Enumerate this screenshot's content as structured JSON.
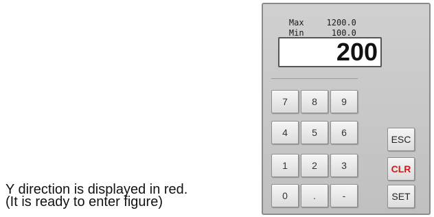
{
  "caption": {
    "line1": "Y direction is displayed in red.",
    "line2": "(It is ready to enter figure)"
  },
  "keypad": {
    "max_label": "Max",
    "max_value": "1200.0",
    "min_label": "Min",
    "min_value": "100.0",
    "display_value": "200",
    "keys": {
      "k7": "7",
      "k8": "8",
      "k9": "9",
      "k4": "4",
      "k5": "5",
      "k6": "6",
      "k1": "1",
      "k2": "2",
      "k3": "3",
      "k0": "0",
      "dot": ".",
      "minus": "-",
      "esc": "ESC",
      "clr": "CLR",
      "set": "SET"
    },
    "colors": {
      "clr_text": "#d01818",
      "panel": "#c8c8c8"
    }
  }
}
